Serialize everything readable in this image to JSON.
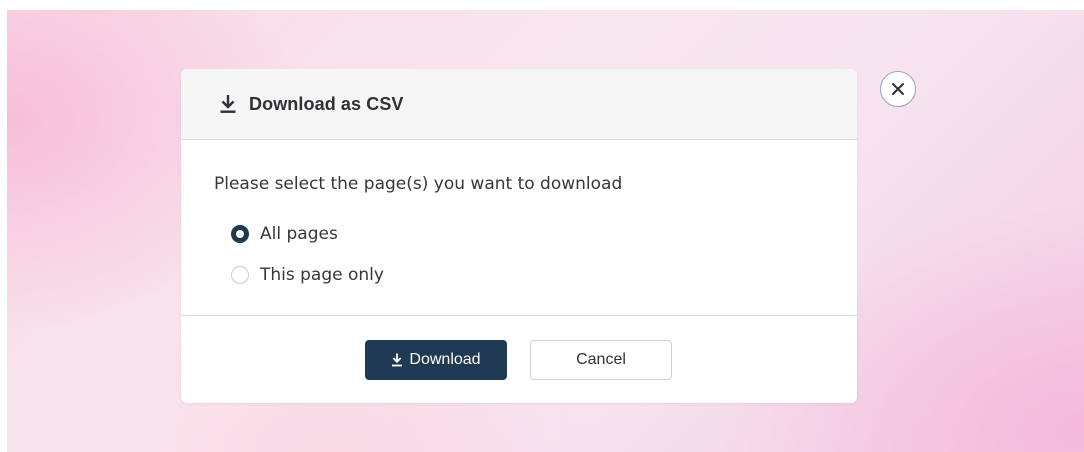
{
  "dialog": {
    "title": "Download as CSV",
    "title_icon": "download-icon",
    "prompt": "Please select the page(s) you want to download",
    "options": [
      {
        "label": "All pages",
        "selected": true
      },
      {
        "label": "This page only",
        "selected": false
      }
    ],
    "download_label": "Download",
    "download_icon": "download-icon",
    "cancel_label": "Cancel",
    "close_icon": "close-icon"
  },
  "colors": {
    "primary": "#1f3a52",
    "radio_checked": "#1e3a50",
    "header_bg": "#f6f6f6",
    "text": "#34373c"
  }
}
